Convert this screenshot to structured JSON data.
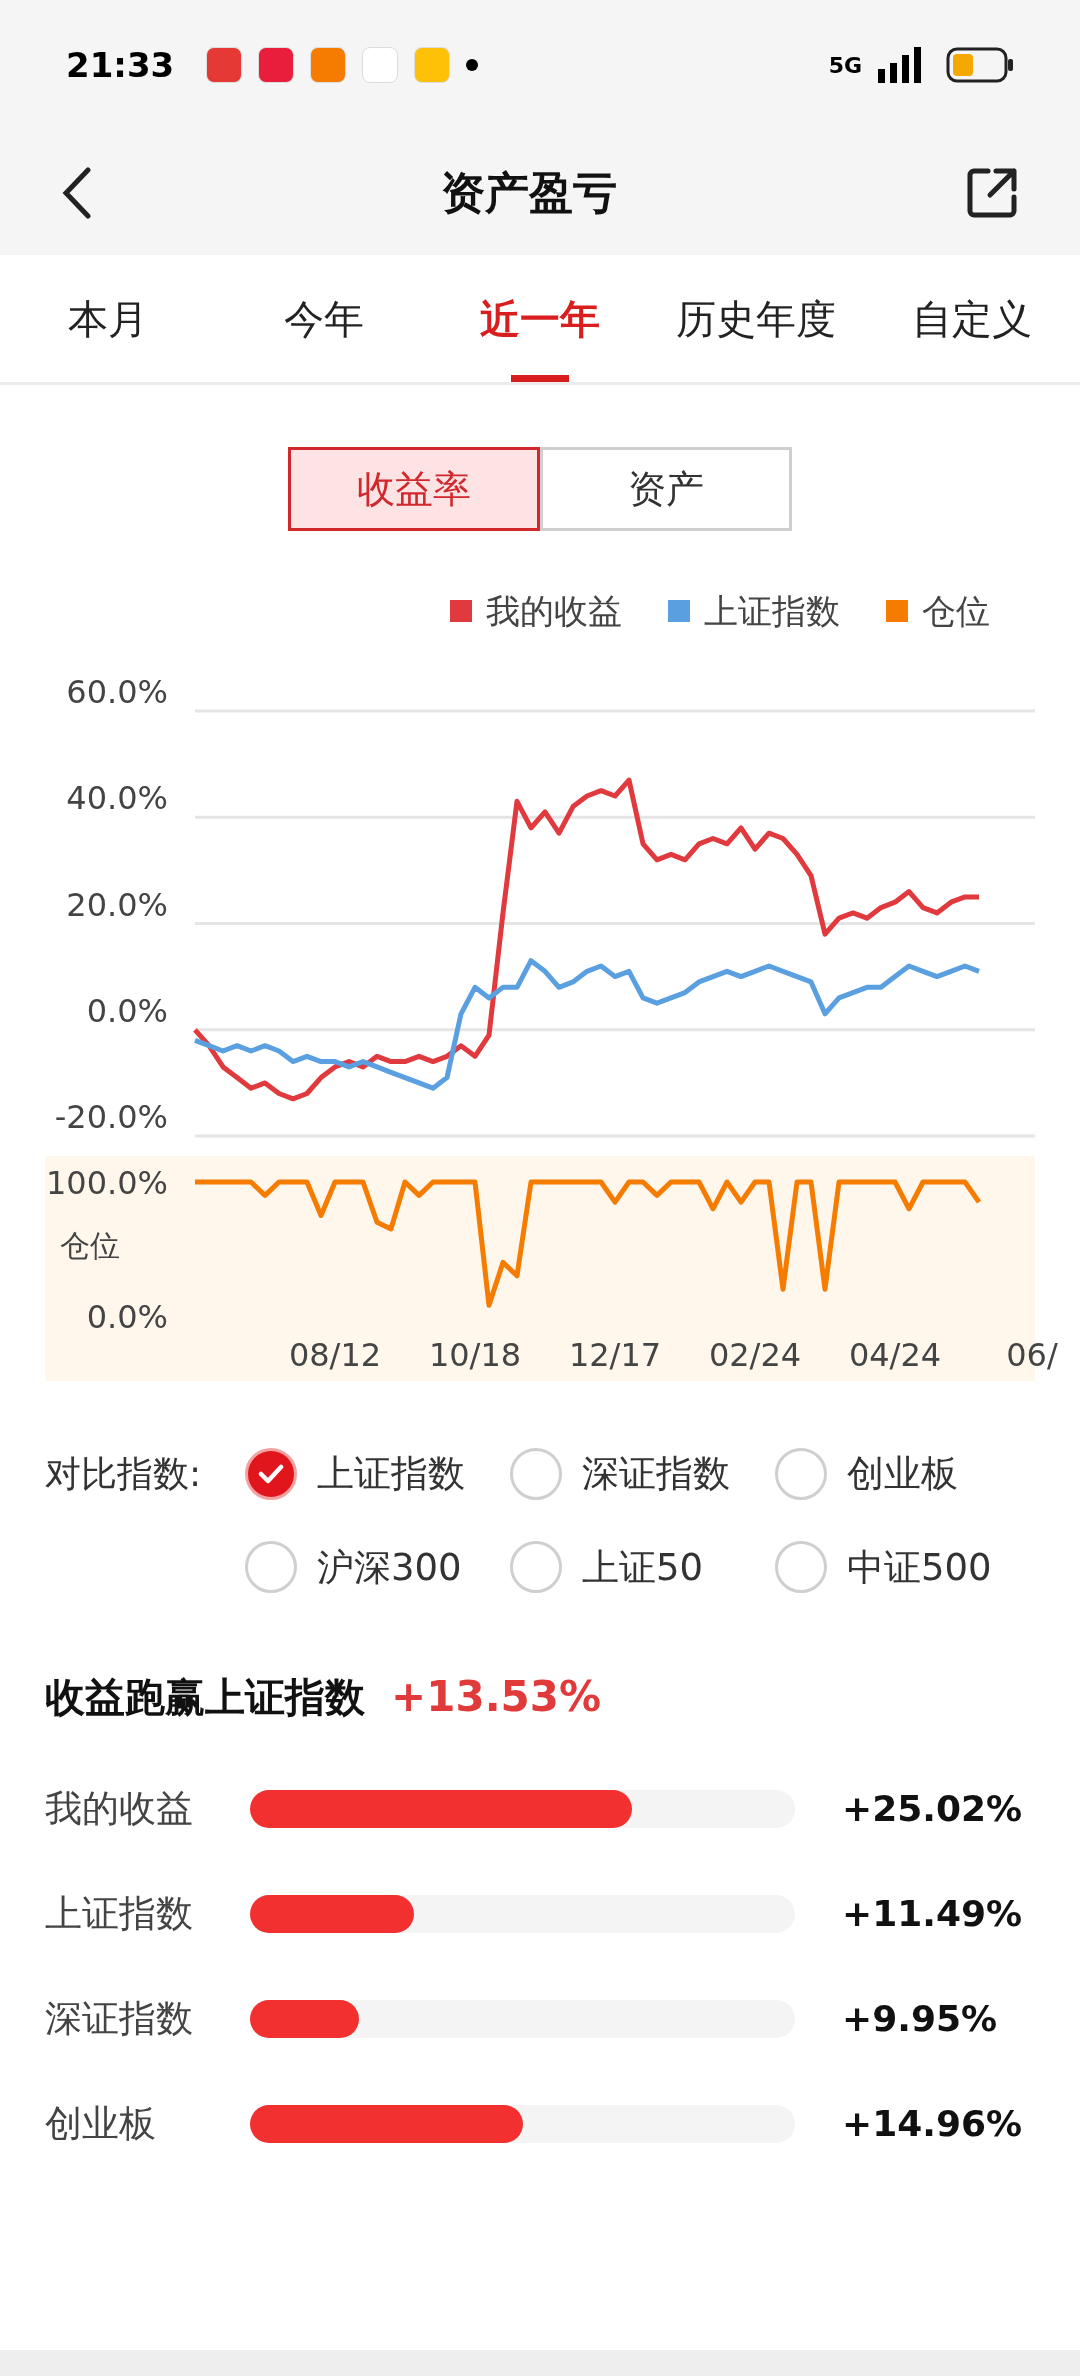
{
  "status_bar": {
    "time": "21:33",
    "network": "5G"
  },
  "header": {
    "title": "资产盈亏"
  },
  "tabs": [
    {
      "label": "本月",
      "selected": false
    },
    {
      "label": "今年",
      "selected": false
    },
    {
      "label": "近一年",
      "selected": true
    },
    {
      "label": "历史年度",
      "selected": false
    },
    {
      "label": "自定义",
      "selected": false
    }
  ],
  "toggle": [
    {
      "label": "收益率",
      "selected": true
    },
    {
      "label": "资产",
      "selected": false
    }
  ],
  "return_chart": {
    "chart_data": {
      "type": "line",
      "grid": true,
      "ylim": [
        -20,
        60
      ],
      "yticks": [
        {
          "value": -20,
          "label": "-20.0%"
        },
        {
          "value": 0,
          "label": "0.0%"
        },
        {
          "value": 20,
          "label": "20.0%"
        },
        {
          "value": 40,
          "label": "40.0%"
        },
        {
          "value": 60,
          "label": "60.0%"
        }
      ],
      "categories": [
        null,
        null,
        null,
        null,
        null,
        null,
        null,
        null,
        null,
        null,
        null,
        null,
        null,
        null,
        null,
        null,
        null,
        null,
        null,
        null,
        null,
        null,
        null,
        null,
        null,
        null,
        null,
        null,
        null,
        null,
        null,
        null,
        null,
        null,
        null,
        null,
        null,
        null,
        null,
        null,
        null,
        null,
        null,
        null,
        null,
        null,
        null,
        null,
        null,
        null,
        null,
        null,
        null,
        null,
        null,
        null,
        null,
        null,
        null,
        null,
        null
      ],
      "series": [
        {
          "name": "我的收益",
          "color": "#e0393e",
          "values": [
            0,
            -3,
            -7,
            -9,
            -11,
            -10,
            -12,
            -13,
            -12,
            -9,
            -7,
            -6,
            -7,
            -5,
            -6,
            -6,
            -5,
            -6,
            -5,
            -3,
            -5,
            -1,
            22,
            43,
            38,
            41,
            37,
            42,
            44,
            45,
            44,
            47,
            35,
            32,
            33,
            32,
            35,
            36,
            35,
            38,
            34,
            37,
            36,
            33,
            29,
            18,
            21,
            22,
            21,
            23,
            24,
            26,
            23,
            22,
            24,
            25,
            25,
            null,
            null,
            null,
            null
          ]
        },
        {
          "name": "上证指数",
          "color": "#5aa0e0",
          "values": [
            -2,
            -3,
            -4,
            -3,
            -4,
            -3,
            -4,
            -6,
            -5,
            -6,
            -6,
            -7,
            -6,
            -7,
            -8,
            -9,
            -10,
            -11,
            -9,
            3,
            8,
            6,
            8,
            8,
            13,
            11,
            8,
            9,
            11,
            12,
            10,
            11,
            6,
            5,
            6,
            7,
            9,
            10,
            11,
            10,
            11,
            12,
            11,
            10,
            9,
            3,
            6,
            7,
            8,
            8,
            10,
            12,
            11,
            10,
            11,
            12,
            11,
            null,
            null,
            null,
            null
          ]
        }
      ]
    }
  },
  "position_chart": {
    "chart_data": {
      "type": "line",
      "ylabel": "仓位",
      "ylim": [
        0,
        100
      ],
      "yticks": [
        {
          "value": 0,
          "label": "0.0%"
        },
        {
          "value": 100,
          "label": "100.0%"
        }
      ],
      "categories": [
        null,
        null,
        null,
        null,
        null,
        null,
        null,
        null,
        null,
        null,
        "08/12",
        null,
        null,
        null,
        null,
        null,
        null,
        null,
        null,
        null,
        "10/18",
        null,
        null,
        null,
        null,
        null,
        null,
        null,
        null,
        null,
        "12/17",
        null,
        null,
        null,
        null,
        null,
        null,
        null,
        null,
        null,
        "02/24",
        null,
        null,
        null,
        null,
        null,
        null,
        null,
        null,
        null,
        "04/24",
        null,
        null,
        null,
        null,
        null,
        null,
        null,
        null,
        null,
        "06/"
      ],
      "series": [
        {
          "name": "仓位",
          "color": "#f57c00",
          "values": [
            100,
            100,
            100,
            100,
            100,
            90,
            100,
            100,
            100,
            75,
            100,
            100,
            100,
            70,
            65,
            100,
            90,
            100,
            100,
            100,
            100,
            8,
            40,
            30,
            100,
            100,
            100,
            100,
            100,
            100,
            85,
            100,
            100,
            90,
            100,
            100,
            100,
            80,
            100,
            85,
            100,
            100,
            20,
            100,
            100,
            20,
            100,
            100,
            100,
            100,
            100,
            80,
            100,
            100,
            100,
            100,
            85,
            null,
            null,
            null,
            null
          ]
        }
      ]
    }
  },
  "compare": {
    "label": "对比指数:",
    "options": [
      {
        "label": "上证指数",
        "selected": true
      },
      {
        "label": "深证指数",
        "selected": false
      },
      {
        "label": "创业板",
        "selected": false
      },
      {
        "label": "沪深300",
        "selected": false
      },
      {
        "label": "上证50",
        "selected": false
      },
      {
        "label": "中证500",
        "selected": false
      }
    ]
  },
  "summary": {
    "title": "收益跑赢上证指数",
    "value": "+13.53%"
  },
  "bars": [
    {
      "label": "我的收益",
      "level": 0.7,
      "value": "+25.02%"
    },
    {
      "label": "上证指数",
      "level": 0.3,
      "value": "+11.49%"
    },
    {
      "label": "深证指数",
      "level": 0.2,
      "value": "+9.95%"
    },
    {
      "label": "创业板",
      "level": 0.5,
      "value": "+14.96%"
    }
  ]
}
